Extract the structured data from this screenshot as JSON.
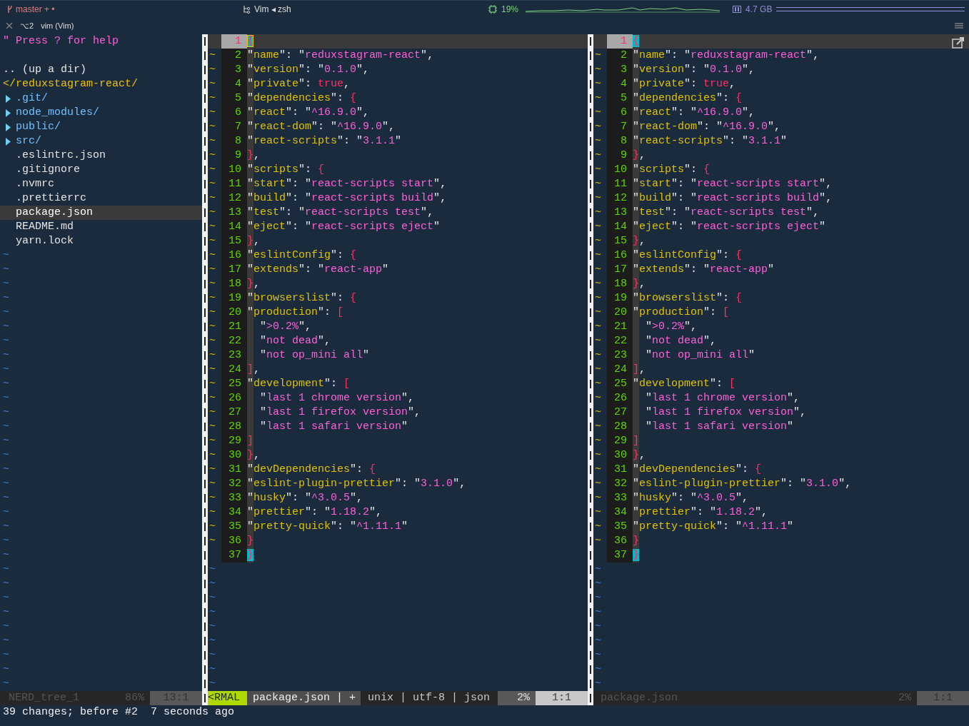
{
  "topbar": {
    "branch": "master + •",
    "session": "Vim ◂ zsh",
    "cpu": "19%",
    "memory": "4.7 GB"
  },
  "tab": {
    "shortcut": "⌥2",
    "title": "vim (Vim)"
  },
  "tree": {
    "items": [
      {
        "kind": "help",
        "text": "\" Press ? for help",
        "selected": false
      },
      {
        "kind": "spacer",
        "selected": false
      },
      {
        "kind": "up",
        "text": ".. (up a dir)",
        "selected": false
      },
      {
        "kind": "root",
        "text": "</reduxstagram-react/",
        "selected": false
      },
      {
        "kind": "dir",
        "text": ".git/",
        "selected": false
      },
      {
        "kind": "dir",
        "text": "node_modules/",
        "selected": false
      },
      {
        "kind": "dir",
        "text": "public/",
        "selected": false
      },
      {
        "kind": "dir",
        "text": "src/",
        "selected": false
      },
      {
        "kind": "file",
        "text": ".eslintrc.json",
        "selected": false
      },
      {
        "kind": "file",
        "text": ".gitignore",
        "selected": false
      },
      {
        "kind": "file",
        "text": ".nvmrc",
        "selected": false
      },
      {
        "kind": "file",
        "text": ".prettierrc",
        "selected": false
      },
      {
        "kind": "file",
        "text": "package.json",
        "selected": true
      },
      {
        "kind": "file",
        "text": "README.md",
        "selected": false
      },
      {
        "kind": "file",
        "text": "yarn.lock",
        "selected": false
      }
    ],
    "end_of_buffer": [
      "~",
      "~",
      "~",
      "~",
      "~",
      "~",
      "~",
      "~",
      "~",
      "~",
      "~",
      "~",
      "~",
      "~",
      "~",
      "~",
      "~",
      "~",
      "~",
      "~",
      "~",
      "~",
      "~",
      "~",
      "~",
      "~",
      "~",
      "~",
      "~",
      "~",
      "~"
    ],
    "status": {
      "name": "NERD_tree_1",
      "percent": "86%",
      "position": "13:1"
    }
  },
  "panes": [
    {
      "active": true,
      "lines": [
        {
          "n": "1",
          "text": "{",
          "current": true,
          "match": true
        },
        {
          "n": "2",
          "mark": "~",
          "text": "\"name\": \"reduxstagram-react\","
        },
        {
          "n": "3",
          "mark": "~",
          "text": "\"version\": \"0.1.0\","
        },
        {
          "n": "4",
          "mark": "~",
          "text": "\"private\": true,"
        },
        {
          "n": "5",
          "mark": "~",
          "text": "\"dependencies\": {"
        },
        {
          "n": "6",
          "mark": "~",
          "text": "\"react\": \"^16.9.0\","
        },
        {
          "n": "7",
          "mark": "~",
          "text": "\"react-dom\": \"^16.9.0\","
        },
        {
          "n": "8",
          "mark": "~",
          "text": "\"react-scripts\": \"3.1.1\""
        },
        {
          "n": "9",
          "mark": "~",
          "text": "},"
        },
        {
          "n": "10",
          "mark": "~",
          "text": "\"scripts\": {"
        },
        {
          "n": "11",
          "mark": "~",
          "text": "\"start\": \"react-scripts start\","
        },
        {
          "n": "12",
          "mark": "~",
          "text": "\"build\": \"react-scripts build\","
        },
        {
          "n": "13",
          "mark": "~",
          "text": "\"test\": \"react-scripts test\","
        },
        {
          "n": "14",
          "mark": "~",
          "text": "\"eject\": \"react-scripts eject\""
        },
        {
          "n": "15",
          "mark": "~",
          "text": "},"
        },
        {
          "n": "16",
          "mark": "~",
          "text": "\"eslintConfig\": {"
        },
        {
          "n": "17",
          "mark": "~",
          "text": "\"extends\": \"react-app\""
        },
        {
          "n": "18",
          "mark": "~",
          "text": "},"
        },
        {
          "n": "19",
          "mark": "~",
          "text": "\"browserslist\": {"
        },
        {
          "n": "20",
          "mark": "~",
          "text": "\"production\": ["
        },
        {
          "n": "21",
          "mark": "~",
          "text": "  \">0.2%\","
        },
        {
          "n": "22",
          "mark": "~",
          "text": "  \"not dead\","
        },
        {
          "n": "23",
          "mark": "~",
          "text": "  \"not op_mini all\""
        },
        {
          "n": "24",
          "mark": "~",
          "text": "],"
        },
        {
          "n": "25",
          "mark": "~",
          "text": "\"development\": ["
        },
        {
          "n": "26",
          "mark": "~",
          "text": "  \"last 1 chrome version\","
        },
        {
          "n": "27",
          "mark": "~",
          "text": "  \"last 1 firefox version\","
        },
        {
          "n": "28",
          "mark": "~",
          "text": "  \"last 1 safari version\""
        },
        {
          "n": "29",
          "mark": "~",
          "text": "]"
        },
        {
          "n": "30",
          "mark": "~",
          "text": "},"
        },
        {
          "n": "31",
          "mark": "~",
          "text": "\"devDependencies\": {"
        },
        {
          "n": "32",
          "mark": "~",
          "text": "\"eslint-plugin-prettier\": \"3.1.0\","
        },
        {
          "n": "33",
          "mark": "~",
          "text": "\"husky\": \"^3.0.5\","
        },
        {
          "n": "34",
          "mark": "~",
          "text": "\"prettier\": \"1.18.2\","
        },
        {
          "n": "35",
          "mark": "~",
          "text": "\"pretty-quick\": \"^1.11.1\""
        },
        {
          "n": "36",
          "mark": "~",
          "text": "}"
        },
        {
          "n": "37",
          "text": "}",
          "match": true
        }
      ],
      "end_of_buffer": [
        "~",
        "~",
        "~",
        "~",
        "~",
        "~",
        "~",
        "~",
        "~"
      ],
      "status": {
        "mode": "<RMAL",
        "file": "package.json | +",
        "info": "unix | utf-8 | json",
        "percent": "2%",
        "position": "1:1"
      }
    },
    {
      "active": false,
      "lines": [
        {
          "n": "1",
          "text": "{",
          "current": true,
          "match": true
        },
        {
          "n": "2",
          "mark": "~",
          "text": "\"name\": \"reduxstagram-react\","
        },
        {
          "n": "3",
          "mark": "~",
          "text": "\"version\": \"0.1.0\","
        },
        {
          "n": "4",
          "mark": "~",
          "text": "\"private\": true,"
        },
        {
          "n": "5",
          "mark": "~",
          "text": "\"dependencies\": {"
        },
        {
          "n": "6",
          "mark": "~",
          "text": "\"react\": \"^16.9.0\","
        },
        {
          "n": "7",
          "mark": "~",
          "text": "\"react-dom\": \"^16.9.0\","
        },
        {
          "n": "8",
          "mark": "~",
          "text": "\"react-scripts\": \"3.1.1\""
        },
        {
          "n": "9",
          "mark": "~",
          "text": "},"
        },
        {
          "n": "10",
          "mark": "~",
          "text": "\"scripts\": {"
        },
        {
          "n": "11",
          "mark": "~",
          "text": "\"start\": \"react-scripts start\","
        },
        {
          "n": "12",
          "mark": "~",
          "text": "\"build\": \"react-scripts build\","
        },
        {
          "n": "13",
          "mark": "~",
          "text": "\"test\": \"react-scripts test\","
        },
        {
          "n": "14",
          "mark": "~",
          "text": "\"eject\": \"react-scripts eject\""
        },
        {
          "n": "15",
          "mark": "~",
          "text": "},"
        },
        {
          "n": "16",
          "mark": "~",
          "text": "\"eslintConfig\": {"
        },
        {
          "n": "17",
          "mark": "~",
          "text": "\"extends\": \"react-app\""
        },
        {
          "n": "18",
          "mark": "~",
          "text": "},"
        },
        {
          "n": "19",
          "mark": "~",
          "text": "\"browserslist\": {"
        },
        {
          "n": "20",
          "mark": "~",
          "text": "\"production\": ["
        },
        {
          "n": "21",
          "mark": "~",
          "text": "  \">0.2%\","
        },
        {
          "n": "22",
          "mark": "~",
          "text": "  \"not dead\","
        },
        {
          "n": "23",
          "mark": "~",
          "text": "  \"not op_mini all\""
        },
        {
          "n": "24",
          "mark": "~",
          "text": "],"
        },
        {
          "n": "25",
          "mark": "~",
          "text": "\"development\": ["
        },
        {
          "n": "26",
          "mark": "~",
          "text": "  \"last 1 chrome version\","
        },
        {
          "n": "27",
          "mark": "~",
          "text": "  \"last 1 firefox version\","
        },
        {
          "n": "28",
          "mark": "~",
          "text": "  \"last 1 safari version\""
        },
        {
          "n": "29",
          "mark": "~",
          "text": "]"
        },
        {
          "n": "30",
          "mark": "~",
          "text": "},"
        },
        {
          "n": "31",
          "mark": "~",
          "text": "\"devDependencies\": {"
        },
        {
          "n": "32",
          "mark": "~",
          "text": "\"eslint-plugin-prettier\": \"3.1.0\","
        },
        {
          "n": "33",
          "mark": "~",
          "text": "\"husky\": \"^3.0.5\","
        },
        {
          "n": "34",
          "mark": "~",
          "text": "\"prettier\": \"1.18.2\","
        },
        {
          "n": "35",
          "mark": "~",
          "text": "\"pretty-quick\": \"^1.11.1\""
        },
        {
          "n": "36",
          "mark": "~",
          "text": "}"
        },
        {
          "n": "37",
          "text": "}",
          "match": true
        }
      ],
      "end_of_buffer": [
        "~",
        "~",
        "~",
        "~",
        "~",
        "~",
        "~",
        "~",
        "~"
      ],
      "status": {
        "file": "package.json",
        "percent": "2%",
        "position": "1:1"
      }
    }
  ],
  "message": "39 changes; before #2  7 seconds ago"
}
